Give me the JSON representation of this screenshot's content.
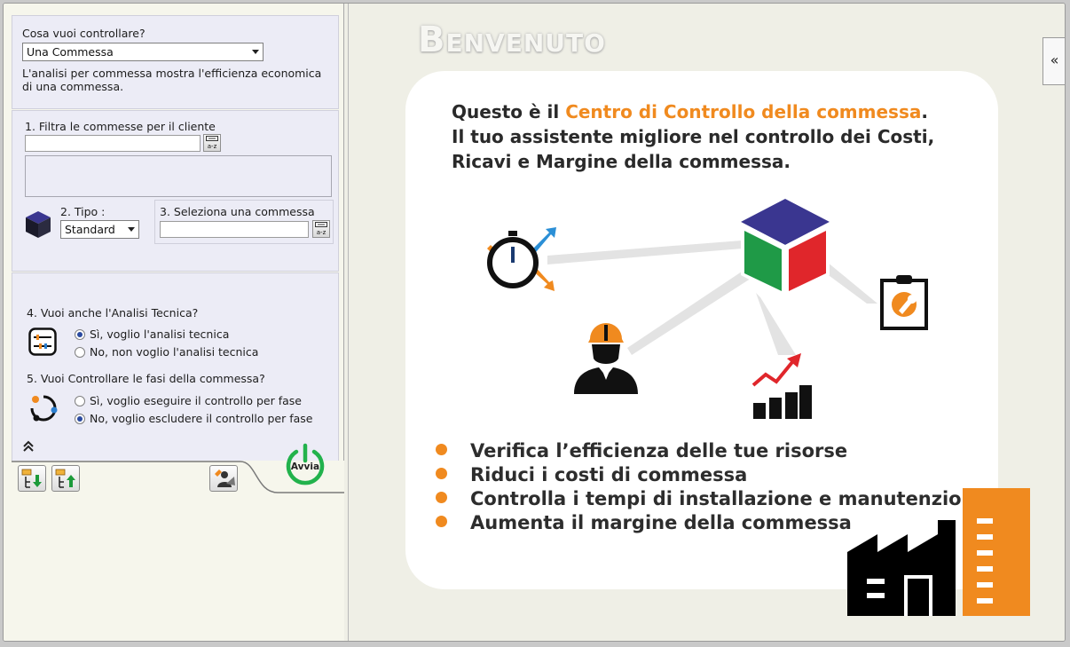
{
  "controllo": {
    "question": "Cosa vuoi controllare?",
    "selected": "Una Commessa",
    "description": "L'analisi per commessa mostra l'efficienza economica di una commessa."
  },
  "filtro": {
    "label": "1. Filtra le commesse per il cliente",
    "sort_label": "a-z"
  },
  "tipo": {
    "label": "2. Tipo :",
    "selected": "Standard"
  },
  "seleziona": {
    "label": "3. Seleziona una commessa",
    "sort_label": "a-z"
  },
  "analisi_tecnica": {
    "question": "4. Vuoi anche l'Analisi Tecnica?",
    "options": [
      "Sì, voglio l'analisi tecnica",
      "No, non voglio l'analisi tecnica"
    ],
    "selected_index": 0
  },
  "fasi": {
    "question": "5. Vuoi Controllare le fasi della commessa?",
    "options": [
      "Sì, voglio eseguire il controllo per fase",
      "No, voglio escludere il controllo per fase"
    ],
    "selected_index": 1
  },
  "toolbar": {
    "run_label": "Avvia"
  },
  "welcome": {
    "title": "Benvenuto",
    "collapse_label": "«",
    "intro_line1_a": "Questo è il ",
    "intro_line1_b": "Centro di Controllo della commessa",
    "intro_line1_c": ".",
    "intro_line2": "Il tuo assistente migliore nel controllo dei Costi,",
    "intro_line3": "Ricavi e Margine della commessa.",
    "bullets": [
      "Verifica l’efficienza delle tue risorse",
      "Riduci i costi di commessa",
      "Controlla i tempi di installazione e manutenzione",
      "Aumenta il margine della commessa"
    ]
  },
  "colors": {
    "accent": "#f08a1f",
    "panel": "#ececf6",
    "cube_top": "#3a3690",
    "cube_left": "#1f9a47",
    "cube_right": "#e0262b",
    "power_green": "#22b24c"
  },
  "icons": [
    "cube-icon",
    "equalizer-icon",
    "phases-icon",
    "collapse-up-icon",
    "export-down-icon",
    "export-up-icon",
    "user-edit-icon",
    "power-icon",
    "stopwatch-icon",
    "worker-icon",
    "growth-chart-icon",
    "clipboard-tool-icon",
    "factory-icon",
    "building-icon"
  ]
}
